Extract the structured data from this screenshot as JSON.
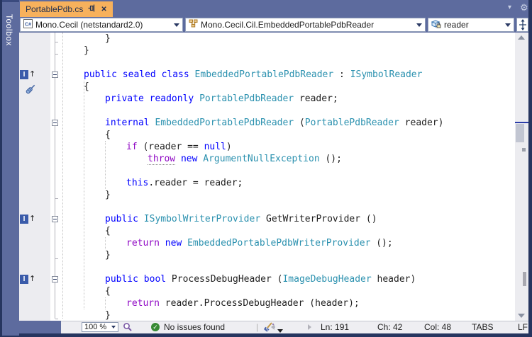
{
  "tab": {
    "title": "PortablePdb.cs"
  },
  "navbar": {
    "project": "Mono.Cecil (netstandard2.0)",
    "type_name": "Mono.Cecil.Cil.EmbeddedPortablePdbReader",
    "member_name": "reader"
  },
  "toolbox": {
    "label": "Toolbox"
  },
  "icons": {
    "close": "✕",
    "gear": "⚙",
    "chevron_down": "▾",
    "check": "✓",
    "up_arrow": "↑",
    "reference_glyph": "I"
  },
  "editor": {
    "lines": [
      {
        "i": 2,
        "s": [
          [
            "}",
            "txt"
          ]
        ]
      },
      {
        "i": 1,
        "s": [
          [
            "}",
            "txt"
          ]
        ]
      },
      {
        "i": 0,
        "s": []
      },
      {
        "i": 1,
        "s": [
          [
            "public sealed class ",
            "kw"
          ],
          [
            "EmbeddedPortablePdbReader",
            "type"
          ],
          [
            " : ",
            "txt"
          ],
          [
            "ISymbolReader",
            "type"
          ]
        ]
      },
      {
        "i": 1,
        "s": [
          [
            "{",
            "txt"
          ]
        ]
      },
      {
        "i": 2,
        "s": [
          [
            "private readonly ",
            "kw"
          ],
          [
            "PortablePdbReader",
            "type"
          ],
          [
            " reader;",
            "txt"
          ]
        ]
      },
      {
        "i": 0,
        "s": []
      },
      {
        "i": 2,
        "s": [
          [
            "internal ",
            "kw"
          ],
          [
            "EmbeddedPortablePdbReader",
            "type"
          ],
          [
            " (",
            "txt"
          ],
          [
            "PortablePdbReader",
            "type"
          ],
          [
            " reader)",
            "txt"
          ]
        ]
      },
      {
        "i": 2,
        "s": [
          [
            "{",
            "txt"
          ]
        ]
      },
      {
        "i": 3,
        "s": [
          [
            "if",
            "ctrl"
          ],
          [
            " (reader == ",
            "txt"
          ],
          [
            "null",
            "kw"
          ],
          [
            ")",
            "txt"
          ]
        ]
      },
      {
        "i": 4,
        "s": [
          [
            "throw",
            "ctrl",
            "u"
          ],
          [
            " ",
            "txt"
          ],
          [
            "new",
            "kw"
          ],
          [
            " ",
            "txt"
          ],
          [
            "ArgumentNullException",
            "type"
          ],
          [
            " ();",
            "txt"
          ]
        ]
      },
      {
        "i": 0,
        "s": []
      },
      {
        "i": 3,
        "s": [
          [
            "this",
            "kw"
          ],
          [
            ".reader = reader;",
            "txt"
          ]
        ]
      },
      {
        "i": 2,
        "s": [
          [
            "}",
            "txt"
          ]
        ]
      },
      {
        "i": 0,
        "s": []
      },
      {
        "i": 2,
        "s": [
          [
            "public ",
            "kw"
          ],
          [
            "ISymbolWriterProvider",
            "type"
          ],
          [
            " GetWriterProvider ()",
            "txt"
          ]
        ]
      },
      {
        "i": 2,
        "s": [
          [
            "{",
            "txt"
          ]
        ]
      },
      {
        "i": 3,
        "s": [
          [
            "return",
            "ctrl"
          ],
          [
            " ",
            "txt"
          ],
          [
            "new",
            "kw"
          ],
          [
            " ",
            "txt"
          ],
          [
            "EmbeddedPortablePdbWriterProvider",
            "type"
          ],
          [
            " ();",
            "txt"
          ]
        ]
      },
      {
        "i": 2,
        "s": [
          [
            "}",
            "txt"
          ]
        ]
      },
      {
        "i": 0,
        "s": []
      },
      {
        "i": 2,
        "s": [
          [
            "public bool ",
            "kw"
          ],
          [
            "ProcessDebugHeader",
            "txt"
          ],
          [
            " (",
            "txt"
          ],
          [
            "ImageDebugHeader",
            "type"
          ],
          [
            " header)",
            "txt"
          ]
        ]
      },
      {
        "i": 2,
        "s": [
          [
            "{",
            "txt"
          ]
        ]
      },
      {
        "i": 3,
        "s": [
          [
            "return",
            "ctrl"
          ],
          [
            " reader.ProcessDebugHeader (header);",
            "txt"
          ]
        ]
      },
      {
        "i": 2,
        "s": [
          [
            "}",
            "txt"
          ]
        ]
      }
    ],
    "reference_glyph_lines": [
      3,
      15,
      20
    ],
    "outline_box_lines": [
      3,
      7,
      15,
      20
    ],
    "outline_tick_lines": [
      0,
      1,
      13,
      18,
      23
    ],
    "quick_action_line": 5
  },
  "statusbar": {
    "zoom_level": "100 %",
    "message": "No issues found",
    "line": "Ln: 191",
    "char": "Ch: 42",
    "column": "Col: 48",
    "indent_mode": "TABS",
    "line_ending": "LF"
  },
  "colors": {
    "active_tab": "#f7b15c",
    "frame": "#5d6b9e",
    "frame_dark": "#26355f",
    "keyword": "#0000ff",
    "control_keyword": "#8f08c4",
    "type": "#2b91af",
    "text": "#1e1e1e",
    "status_bg": "#eeeef2",
    "health_green": "#388a34"
  }
}
